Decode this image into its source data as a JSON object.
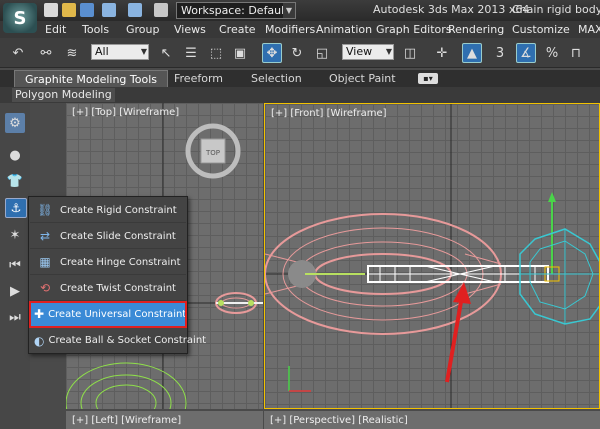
{
  "titlebar": {
    "workspace_label": "Workspace: Default",
    "app_title": "Autodesk 3ds Max  2013 x64",
    "file_title": "Chain rigid body.ma"
  },
  "menu": [
    "Edit",
    "Tools",
    "Group",
    "Views",
    "Create",
    "Modifiers",
    "Animation",
    "Graph Editors",
    "Rendering",
    "Customize",
    "MAX"
  ],
  "toolbar": {
    "filter_value": "All",
    "refcoord_value": "View",
    "snap_label": "3"
  },
  "ribbon": {
    "tabs": [
      "Graphite Modeling Tools",
      "Freeform",
      "Selection",
      "Object Paint"
    ],
    "panel_label": "Polygon Modeling"
  },
  "viewports": {
    "top": "[+] [Top] [Wireframe]",
    "front": "[+] [Front] [Wireframe]",
    "left": "[+] [Left] [Wireframe]",
    "perspective": "[+] [Perspective] [Realistic]"
  },
  "viewcube_label": "TOP",
  "flyout": {
    "items": [
      {
        "label": "Create Rigid Constraint",
        "icon": "rigid-constraint-icon"
      },
      {
        "label": "Create Slide Constraint",
        "icon": "slide-constraint-icon"
      },
      {
        "label": "Create Hinge Constraint",
        "icon": "hinge-constraint-icon"
      },
      {
        "label": "Create Twist Constraint",
        "icon": "twist-constraint-icon"
      },
      {
        "label": "Create Universal Constraint",
        "icon": "universal-constraint-icon",
        "selected": true
      },
      {
        "label": "Create Ball & Socket Constraint",
        "icon": "ball-socket-constraint-icon"
      }
    ]
  },
  "colors": {
    "selection_blue": "#3a8ad6",
    "highlight_red": "#e02020",
    "active_viewport_border": "#f2c200",
    "chain_pink": "#e79a9a",
    "wire_cyan": "#39c8d2"
  }
}
